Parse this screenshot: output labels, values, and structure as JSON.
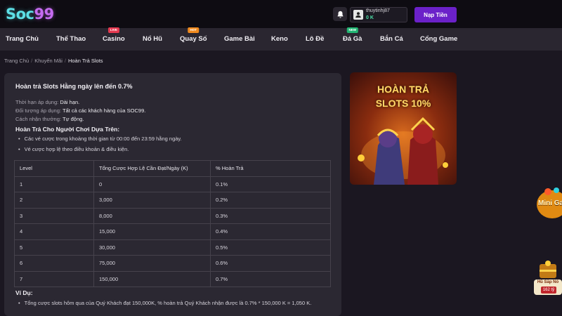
{
  "header": {
    "logo": {
      "main": "Soc",
      "suffix": "99"
    },
    "user": {
      "username": "thuytinhj87",
      "balance": "0 K"
    },
    "deposit_label": "Nạp Tiền"
  },
  "nav": {
    "items": [
      {
        "label": "Trang Chủ",
        "badge": ""
      },
      {
        "label": "Thể Thao",
        "badge": ""
      },
      {
        "label": "Casino",
        "badge": "LIVE"
      },
      {
        "label": "Nổ Hũ",
        "badge": ""
      },
      {
        "label": "Quay Số",
        "badge": "HOT"
      },
      {
        "label": "Game Bài",
        "badge": ""
      },
      {
        "label": "Keno",
        "badge": ""
      },
      {
        "label": "Lô Đề",
        "badge": ""
      },
      {
        "label": "Đá Gà",
        "badge": "NEW"
      },
      {
        "label": "Bắn Cá",
        "badge": ""
      },
      {
        "label": "Cổng Game",
        "badge": ""
      }
    ]
  },
  "breadcrumb": {
    "home": "Trang Chủ",
    "section": "Khuyến Mãi",
    "current": "Hoàn Trả Slots",
    "separator": "/"
  },
  "promo": {
    "title": "Hoàn trả Slots Hằng ngày lên đến 0.7%",
    "duration_label": "Thời hạn áp dụng:",
    "duration_value": "Dài hạn.",
    "audience_label": "Đối tượng áp dụng:",
    "audience_value": "Tất cả các khách hàng của SOC99.",
    "method_label": "Cách nhận thưởng:",
    "method_value": "Tự động.",
    "basis_heading": "Hoàn Trả Cho Người Chơi Dựa Trên:",
    "basis_points": [
      "Các vé cược trong khoảng thời gian từ 00:00 đến 23:59 hằng ngày.",
      "Vé cược hợp lệ theo điều khoản & điều kiện."
    ],
    "table": {
      "headers": [
        "Level",
        "Tổng Cược Hợp Lệ Cần Đạt/Ngày (K)",
        "% Hoàn Trả"
      ],
      "rows": [
        [
          "1",
          "0",
          "0.1%"
        ],
        [
          "2",
          "3,000",
          "0.2%"
        ],
        [
          "3",
          "8,000",
          "0.3%"
        ],
        [
          "4",
          "15,000",
          "0.4%"
        ],
        [
          "5",
          "30,000",
          "0.5%"
        ],
        [
          "6",
          "75,000",
          "0.6%"
        ],
        [
          "7",
          "150,000",
          "0.7%"
        ]
      ]
    },
    "example_heading": "Ví Dụ:",
    "example_text": "Tổng cược slots hôm qua của Quý Khách đạt 150,000K, % hoàn trả Quý Khách nhận được là 0.7% * 150,000 K = 1,050 K."
  },
  "banner": {
    "line1": "HOÀN TRẢ",
    "line2": "SLOTS 10%"
  },
  "widgets": {
    "mini_game": "Mini Game",
    "jackpot_label": "Hũ Sắp Nổ",
    "jackpot_value": "162 tỷ"
  },
  "colors": {
    "accent": "#6b21c9",
    "balance": "#4ce0a8",
    "live": "#e53950",
    "hot": "#f08a1e",
    "new": "#22b573"
  }
}
